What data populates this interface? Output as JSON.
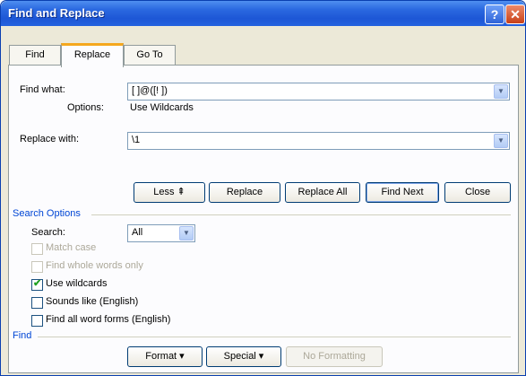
{
  "window": {
    "title": "Find and Replace",
    "help_glyph": "?",
    "close_glyph": "✕"
  },
  "tabs": [
    "Find",
    "Replace",
    "Go To"
  ],
  "find": {
    "label": "Find what:",
    "value": "[ ]@([! ])",
    "options_label": "Options:",
    "options_value": "Use Wildcards"
  },
  "replace": {
    "label": "Replace with:",
    "value": "\\1"
  },
  "buttons": {
    "less": "Less ⇞",
    "replace": "Replace",
    "replace_all": "Replace All",
    "find_next": "Find Next",
    "close": "Close"
  },
  "search_options": {
    "header": "Search Options",
    "search_label": "Search:",
    "search_value": "All",
    "checkboxes": [
      {
        "label": "Match case",
        "checked": false,
        "enabled": false
      },
      {
        "label": "Find whole words only",
        "checked": false,
        "enabled": false
      },
      {
        "label": "Use wildcards",
        "checked": true,
        "enabled": true
      },
      {
        "label": "Sounds like (English)",
        "checked": false,
        "enabled": true
      },
      {
        "label": "Find all word forms (English)",
        "checked": false,
        "enabled": true
      }
    ]
  },
  "find_section": {
    "header": "Find",
    "format_button": "Format ▾",
    "special_button": "Special ▾",
    "no_formatting_button": "No Formatting"
  },
  "icons": {
    "dropdown": "▼",
    "check": "✔"
  }
}
